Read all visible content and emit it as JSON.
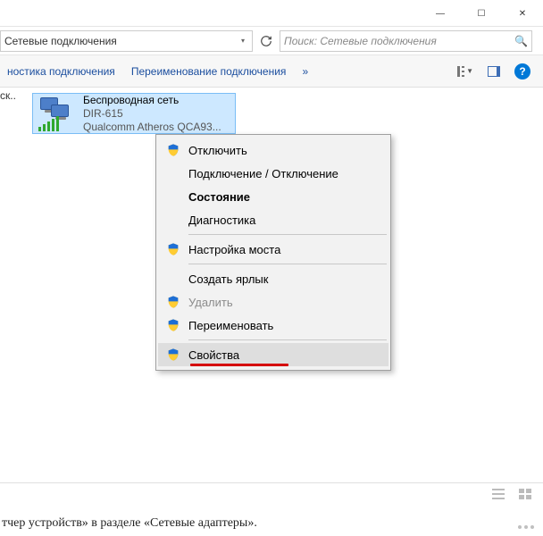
{
  "titlebar": {
    "minimize": "—",
    "maximize": "☐",
    "close": "✕"
  },
  "address": {
    "path": "Сетевые подключения",
    "search_placeholder": "Поиск: Сетевые подключения"
  },
  "toolbar": {
    "diag": "ностика подключения",
    "rename": "Переименование подключения",
    "expand": "»"
  },
  "nav_sidebar_hint": "ск...",
  "network_item": {
    "line1": "Беспроводная сеть",
    "line2": "DIR-615",
    "line3": "Qualcomm Atheros QCA93..."
  },
  "context_menu": {
    "items": [
      {
        "label": "Отключить",
        "shield": true
      },
      {
        "label": "Подключение / Отключение"
      },
      {
        "label": "Состояние",
        "bold": true
      },
      {
        "label": "Диагностика"
      },
      {
        "sep": true
      },
      {
        "label": "Настройка моста",
        "shield": true
      },
      {
        "sep": true
      },
      {
        "label": "Создать ярлык"
      },
      {
        "label": "Удалить",
        "shield": true,
        "disabled": true
      },
      {
        "label": "Переименовать",
        "shield": true
      },
      {
        "sep": true
      },
      {
        "label": "Свойства",
        "shield": true,
        "hover": true,
        "underline": true
      }
    ]
  },
  "footer": "тчер устройств» в разделе «Сетевые адаптеры»."
}
